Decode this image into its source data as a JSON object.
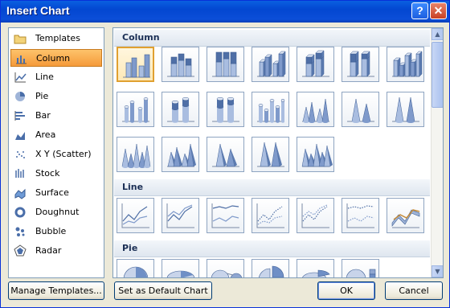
{
  "window": {
    "title": "Insert Chart",
    "help_glyph": "?",
    "close_glyph": "✕"
  },
  "categories": [
    {
      "label": "Templates",
      "icon": "folder-icon",
      "selected": false
    },
    {
      "label": "Column",
      "icon": "column-chart-icon",
      "selected": true
    },
    {
      "label": "Line",
      "icon": "line-chart-icon",
      "selected": false
    },
    {
      "label": "Pie",
      "icon": "pie-chart-icon",
      "selected": false
    },
    {
      "label": "Bar",
      "icon": "bar-chart-icon",
      "selected": false
    },
    {
      "label": "Area",
      "icon": "area-chart-icon",
      "selected": false
    },
    {
      "label": "X Y (Scatter)",
      "icon": "scatter-chart-icon",
      "selected": false
    },
    {
      "label": "Stock",
      "icon": "stock-chart-icon",
      "selected": false
    },
    {
      "label": "Surface",
      "icon": "surface-chart-icon",
      "selected": false
    },
    {
      "label": "Doughnut",
      "icon": "doughnut-chart-icon",
      "selected": false
    },
    {
      "label": "Bubble",
      "icon": "bubble-chart-icon",
      "selected": false
    },
    {
      "label": "Radar",
      "icon": "radar-chart-icon",
      "selected": false
    }
  ],
  "sections": [
    {
      "title": "Column",
      "rows": [
        [
          "clustered-column",
          "stacked-column",
          "100pct-stacked-column",
          "3d-clustered-column",
          "3d-stacked-column",
          "3d-100pct-stacked-column",
          "3d-column"
        ],
        [
          "clustered-cylinder",
          "stacked-cylinder",
          "100pct-stacked-cylinder",
          "3d-cylinder",
          "clustered-cone",
          "stacked-cone",
          "100pct-stacked-cone"
        ],
        [
          "3d-cone",
          "clustered-pyramid",
          "stacked-pyramid",
          "100pct-stacked-pyramid",
          "3d-pyramid"
        ]
      ],
      "selected": "clustered-column"
    },
    {
      "title": "Line",
      "rows": [
        [
          "line",
          "stacked-line",
          "100pct-stacked-line",
          "line-with-markers",
          "stacked-line-with-markers",
          "100pct-stacked-line-with-markers",
          "3d-line"
        ]
      ]
    },
    {
      "title": "Pie",
      "rows": [
        [
          "pie",
          "3d-pie",
          "pie-of-pie",
          "exploded-pie",
          "3d-exploded-pie",
          "bar-of-pie"
        ]
      ]
    }
  ],
  "buttons": {
    "manage_templates": "Manage Templates...",
    "set_default": "Set as Default Chart",
    "ok": "OK",
    "cancel": "Cancel"
  },
  "scroll": {
    "up_glyph": "▲",
    "down_glyph": "▼"
  }
}
